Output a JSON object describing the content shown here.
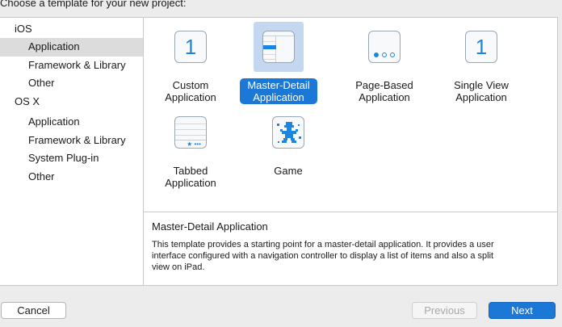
{
  "header": {
    "title": "Choose a template for your new project:"
  },
  "sidebar": {
    "groups": [
      {
        "label": "iOS",
        "items": [
          "Application",
          "Framework & Library",
          "Other"
        ]
      },
      {
        "label": "OS X",
        "items": [
          "Application",
          "Framework & Library",
          "System Plug-in",
          "Other"
        ]
      }
    ],
    "selected": "iOS / Application"
  },
  "templates": [
    {
      "line1": "Custom",
      "line2": "Application",
      "icon": "number-one-icon",
      "glyph": "1"
    },
    {
      "line1": "Master-Detail",
      "line2": "Application",
      "icon": "master-detail-icon",
      "selected": true
    },
    {
      "line1": "Page-Based",
      "line2": "Application",
      "icon": "page-based-icon"
    },
    {
      "line1": "Single View",
      "line2": "Application",
      "icon": "number-one-icon",
      "glyph": "1"
    },
    {
      "line1": "Tabbed",
      "line2": "Application",
      "icon": "tabbed-icon",
      "tab_glyph": "★ •••"
    },
    {
      "line1": "Game",
      "line2": "",
      "icon": "game-icon"
    }
  ],
  "description": {
    "title": "Master-Detail Application",
    "body": "This template provides a starting point for a master-detail application. It provides a user interface configured with a navigation controller to display a list of items and also a split view on iPad."
  },
  "buttons": {
    "cancel": "Cancel",
    "previous": "Previous",
    "next": "Next"
  },
  "colors": {
    "accent": "#1c78d6",
    "selection_bg": "#c3d8f0",
    "icon_blue": "#1b86e2"
  }
}
